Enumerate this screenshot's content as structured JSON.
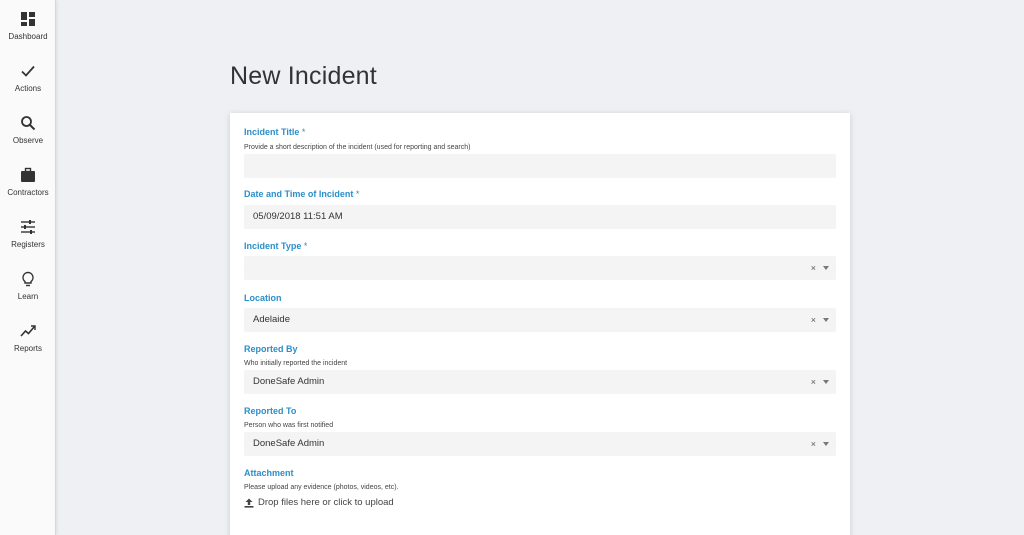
{
  "sidebar": {
    "items": [
      {
        "label": "Dashboard",
        "icon": "dashboard-icon"
      },
      {
        "label": "Actions",
        "icon": "check-icon"
      },
      {
        "label": "Observe",
        "icon": "search-icon"
      },
      {
        "label": "Contractors",
        "icon": "briefcase-icon"
      },
      {
        "label": "Registers",
        "icon": "sliders-icon"
      },
      {
        "label": "Learn",
        "icon": "lightbulb-icon"
      },
      {
        "label": "Reports",
        "icon": "trend-icon"
      }
    ]
  },
  "page": {
    "title": "New Incident"
  },
  "form": {
    "required_marker": "*",
    "incident_title": {
      "label": "Incident Title",
      "help": "Provide a short description of the incident (used for reporting and search)",
      "value": ""
    },
    "date_time": {
      "label": "Date and Time of Incident",
      "value": "05/09/2018 11:51 AM"
    },
    "incident_type": {
      "label": "Incident Type",
      "value": ""
    },
    "location": {
      "label": "Location",
      "value": "Adelaide"
    },
    "reported_by": {
      "label": "Reported By",
      "help": "Who initially reported the incident",
      "value": "DoneSafe Admin"
    },
    "reported_to": {
      "label": "Reported To",
      "help": "Person who was first notified",
      "value": "DoneSafe Admin"
    },
    "attachment": {
      "label": "Attachment",
      "help": "Please upload any evidence (photos, videos, etc).",
      "drop_text": "Drop files here or click to upload"
    },
    "clear_glyph": "×"
  },
  "colors": {
    "accent": "#2b8fc9",
    "background": "#eef0f4",
    "input_bg": "#f4f4f4"
  }
}
